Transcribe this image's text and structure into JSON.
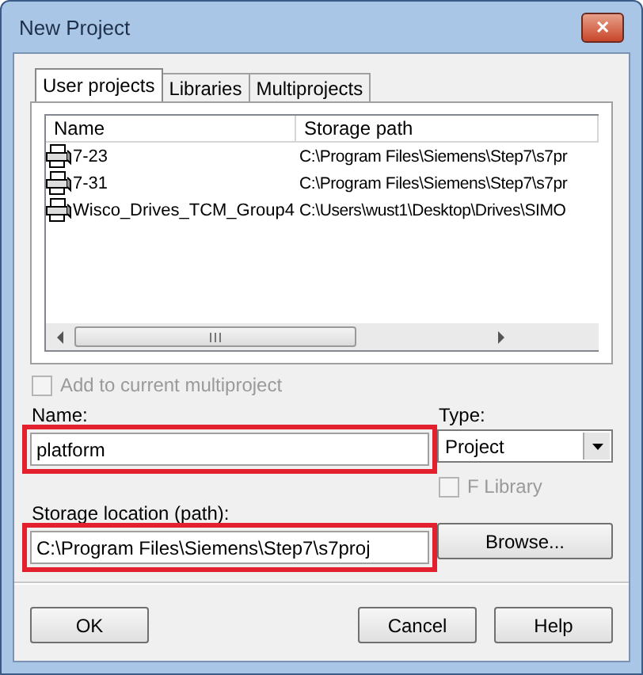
{
  "window": {
    "title": "New Project",
    "close_icon": "✕"
  },
  "tabs": [
    {
      "label": "User projects",
      "selected": true
    },
    {
      "label": "Libraries",
      "selected": false
    },
    {
      "label": "Multiprojects",
      "selected": false
    }
  ],
  "table": {
    "columns": [
      "Name",
      "Storage path"
    ],
    "rows": [
      {
        "name": "7-23",
        "path": "C:\\Program Files\\Siemens\\Step7\\s7pr",
        "selected": false
      },
      {
        "name": "7-31",
        "path": "C:\\Program Files\\Siemens\\Step7\\s7pr",
        "selected": false
      },
      {
        "name": "Wisco_Drives_TCM_Group4",
        "path": "C:\\Users\\wust1\\Desktop\\Drives\\SIMO",
        "selected": false
      }
    ]
  },
  "add_to_multiproject": {
    "label": "Add to current multiproject",
    "checked": false,
    "disabled": true
  },
  "name_field": {
    "label": "Name:",
    "value": "platform",
    "highlighted": true
  },
  "type_field": {
    "label": "Type:",
    "value": "Project"
  },
  "f_library": {
    "label": "F Library",
    "checked": false,
    "disabled": true
  },
  "storage_field": {
    "label": "Storage location (path):",
    "value": "C:\\Program Files\\Siemens\\Step7\\s7proj",
    "highlighted": true
  },
  "browse_button": "Browse...",
  "buttons": [
    "OK",
    "Cancel",
    "Help"
  ]
}
